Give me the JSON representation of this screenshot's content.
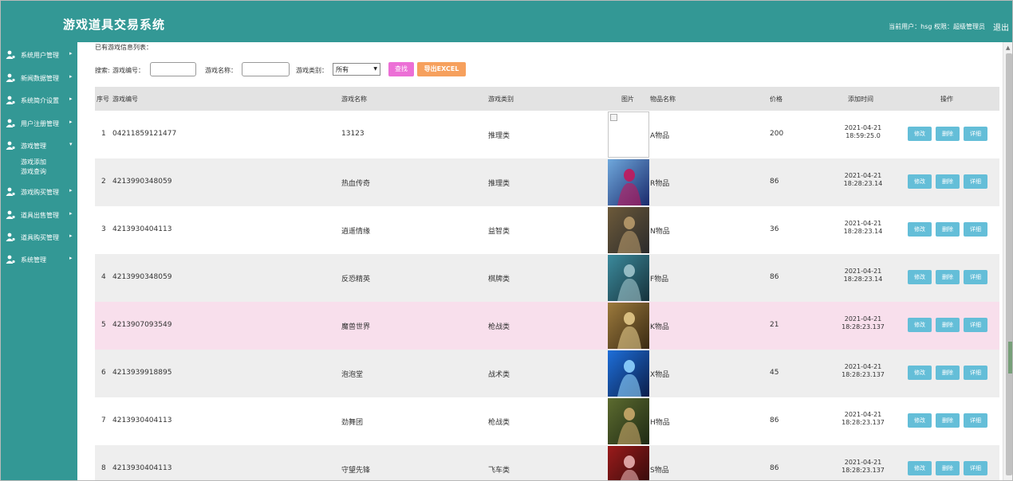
{
  "header": {
    "title": "游戏道具交易系统",
    "user_info": "当前用户：hsg  权限：超级管理员",
    "logout": "退出"
  },
  "sidebar": {
    "items": [
      {
        "label": "系统用户管理",
        "icon": "user-icon"
      },
      {
        "label": "新闻数据管理",
        "icon": "user-icon"
      },
      {
        "label": "系统简介设置",
        "icon": "user-icon"
      },
      {
        "label": "用户注册管理",
        "icon": "user-icon"
      },
      {
        "label": "游戏管理",
        "icon": "user-icon",
        "expanded": true,
        "children": [
          "游戏添加",
          "游戏查询"
        ]
      },
      {
        "label": "游戏购买管理",
        "icon": "user-icon"
      },
      {
        "label": "道具出售管理",
        "icon": "user-icon"
      },
      {
        "label": "道具购买管理",
        "icon": "user-icon"
      },
      {
        "label": "系统管理",
        "icon": "user-icon"
      }
    ]
  },
  "main": {
    "list_heading": "已有游戏信息列表：",
    "search": {
      "label_search": "搜索:",
      "label_code": "游戏编号：",
      "code_value": "",
      "label_name": "游戏名称：",
      "name_value": "",
      "label_type": "游戏类别：",
      "type_selected": "所有",
      "find_button": "查找",
      "export_button": "导出EXCEL"
    },
    "table": {
      "headers": [
        "序号",
        "游戏编号",
        "游戏名称",
        "游戏类别",
        "图片",
        "物品名称",
        "价格",
        "添加时间",
        "操作"
      ],
      "action_labels": [
        "修改",
        "删除",
        "详细"
      ],
      "rows": [
        {
          "idx": "1",
          "code": "04211859121477",
          "name": "13123",
          "type": "推理类",
          "item": "A物品",
          "price": "200",
          "date": "2021-04-21",
          "time": "18:59:25.0",
          "image": "broken"
        },
        {
          "idx": "2",
          "code": "4213990348059",
          "name": "热血传奇",
          "type": "推理类",
          "item": "R物品",
          "price": "86",
          "date": "2021-04-21",
          "time": "18:28:23.14",
          "image": "blue"
        },
        {
          "idx": "3",
          "code": "4213930404113",
          "name": "逍遥情缘",
          "type": "益智类",
          "item": "N物品",
          "price": "36",
          "date": "2021-04-21",
          "time": "18:28:23.14",
          "image": "dark"
        },
        {
          "idx": "4",
          "code": "4213990348059",
          "name": "反恐精英",
          "type": "棋牌类",
          "item": "F物品",
          "price": "86",
          "date": "2021-04-21",
          "time": "18:28:23.14",
          "image": "teal"
        },
        {
          "idx": "5",
          "code": "4213907093549",
          "name": "魔兽世界",
          "type": "枪战类",
          "item": "K物品",
          "price": "21",
          "date": "2021-04-21",
          "time": "18:28:23.137",
          "image": "gold"
        },
        {
          "idx": "6",
          "code": "4213939918895",
          "name": "泡泡堂",
          "type": "战术类",
          "item": "X物品",
          "price": "45",
          "date": "2021-04-21",
          "time": "18:28:23.137",
          "image": "electric"
        },
        {
          "idx": "7",
          "code": "4213930404113",
          "name": "劲舞团",
          "type": "枪战类",
          "item": "H物品",
          "price": "86",
          "date": "2021-04-21",
          "time": "18:28:23.137",
          "image": "forest"
        },
        {
          "idx": "8",
          "code": "4213930404113",
          "name": "守望先锋",
          "type": "飞车类",
          "item": "S物品",
          "price": "86",
          "date": "2021-04-21",
          "time": "18:28:23.137",
          "image": "red"
        }
      ]
    }
  },
  "colors": {
    "brand": "#339895",
    "find_button": "#ec6fd6",
    "export_button": "#f6a05d",
    "action_button": "#64bed8",
    "highlight_row": "#f8dfec"
  }
}
